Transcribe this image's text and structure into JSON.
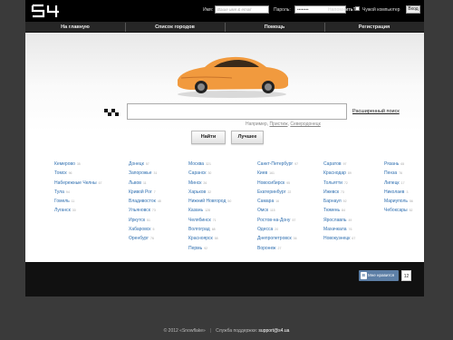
{
  "header": {
    "logo": "S4",
    "name_label": "Имя:",
    "name_placeholder": "Ваше имя & email",
    "password_label": "Пароль:",
    "password_value": "••••••••",
    "remember_label": "Напомнить?",
    "foreign_computer_label": "Чужой компьютер",
    "login_button": "Вход"
  },
  "nav": [
    {
      "label": "На главную"
    },
    {
      "label": "Список городов"
    },
    {
      "label": "Помощь"
    },
    {
      "label": "Регистрация"
    }
  ],
  "search": {
    "advanced_link": "Расширенный поиск",
    "hint_prefix": "Например, ",
    "hint_examples": [
      "Пристиж",
      "Северодонецк"
    ],
    "find_button": "Найти",
    "best_button": "Лучшее"
  },
  "city_columns": [
    [
      {
        "name": "Кемерово",
        "count": "35"
      },
      {
        "name": "Томск",
        "count": "96"
      },
      {
        "name": "Набережные Челны",
        "count": "67"
      },
      {
        "name": "Тула",
        "count": "94"
      },
      {
        "name": "Гомель",
        "count": "11"
      },
      {
        "name": "Луганск",
        "count": "30"
      }
    ],
    [
      {
        "name": "Донецк",
        "count": "57"
      },
      {
        "name": "Запорожье",
        "count": "31"
      },
      {
        "name": "Львов",
        "count": "11"
      },
      {
        "name": "Кривой Рог",
        "count": "7"
      },
      {
        "name": "Владивосток",
        "count": "48"
      },
      {
        "name": "Ульяновск",
        "count": "73"
      },
      {
        "name": "Иркутск",
        "count": "51"
      },
      {
        "name": "Хабаровск",
        "count": "5"
      },
      {
        "name": "Оренбург",
        "count": "76"
      }
    ],
    [
      {
        "name": "Москва",
        "count": "321"
      },
      {
        "name": "Саранск",
        "count": "30"
      },
      {
        "name": "Минск",
        "count": "26"
      },
      {
        "name": "Харьков",
        "count": "32"
      },
      {
        "name": "Нижний Новгород",
        "count": "50"
      },
      {
        "name": "Казань",
        "count": "128"
      },
      {
        "name": "Челябинск",
        "count": "71"
      },
      {
        "name": "Волгоград",
        "count": "68"
      },
      {
        "name": "Красноярск",
        "count": "58"
      },
      {
        "name": "Пермь",
        "count": "92"
      }
    ],
    [
      {
        "name": "Санкт-Петербург",
        "count": "97"
      },
      {
        "name": "Киев",
        "count": "161"
      },
      {
        "name": "Новосибирск",
        "count": "95"
      },
      {
        "name": "Екатеринбург",
        "count": "22"
      },
      {
        "name": "Самара",
        "count": "16"
      },
      {
        "name": "Омск",
        "count": "115"
      },
      {
        "name": "Ростов-на-Дону",
        "count": "57"
      },
      {
        "name": "Одесса",
        "count": "20"
      },
      {
        "name": "Днепропетровск",
        "count": "36"
      },
      {
        "name": "Воронеж",
        "count": "27"
      }
    ],
    [
      {
        "name": "Саратов",
        "count": "97"
      },
      {
        "name": "Краснодар",
        "count": "89"
      },
      {
        "name": "Тольятти",
        "count": "72"
      },
      {
        "name": "Ижевск",
        "count": "73"
      },
      {
        "name": "Барнаул",
        "count": "92"
      },
      {
        "name": "Тюмень",
        "count": "84"
      },
      {
        "name": "Ярославль",
        "count": "49"
      },
      {
        "name": "Махачкала",
        "count": "76"
      },
      {
        "name": "Новокузнецк",
        "count": "67"
      }
    ],
    [
      {
        "name": "Рязань",
        "count": "65"
      },
      {
        "name": "Пенза",
        "count": "76"
      },
      {
        "name": "Липецк",
        "count": "17"
      },
      {
        "name": "Николаев",
        "count": "3"
      },
      {
        "name": "Мариуполь",
        "count": "56"
      },
      {
        "name": "Чебоксары",
        "count": "52"
      }
    ]
  ],
  "like": {
    "label": "Мне нравится",
    "count": "12"
  },
  "footer": {
    "copyright": "© 2012 «Snowflake»",
    "support_label": "Служба поддержки:",
    "support_email": "support@s4.ua"
  },
  "colors": {
    "link": "#2f6fb0",
    "car": "#f19a3e",
    "header_bg": "#000000",
    "page_bg": "#3a3a3a"
  }
}
